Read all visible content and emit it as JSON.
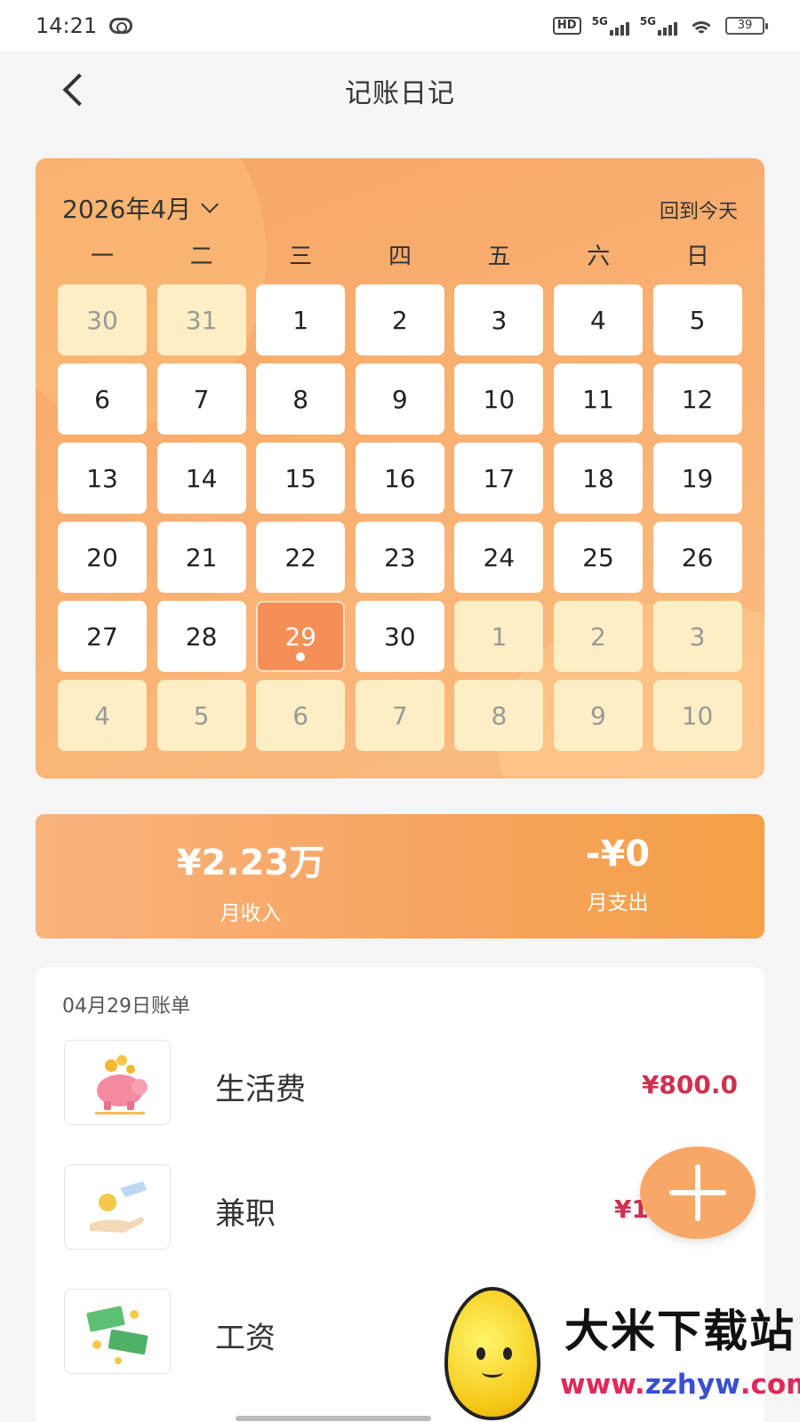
{
  "status_bar": {
    "time": "14:21",
    "hd_label": "HD",
    "signal1_label": "5G",
    "signal2_label": "5G",
    "battery": "39"
  },
  "header": {
    "title": "记账日记"
  },
  "calendar": {
    "month_label": "2026年4月",
    "today_button": "回到今天",
    "weekdays": [
      "一",
      "二",
      "三",
      "四",
      "五",
      "六",
      "日"
    ],
    "selected_day": "29",
    "days": [
      {
        "d": "30",
        "out": true
      },
      {
        "d": "31",
        "out": true
      },
      {
        "d": "1"
      },
      {
        "d": "2"
      },
      {
        "d": "3"
      },
      {
        "d": "4"
      },
      {
        "d": "5"
      },
      {
        "d": "6"
      },
      {
        "d": "7"
      },
      {
        "d": "8"
      },
      {
        "d": "9"
      },
      {
        "d": "10"
      },
      {
        "d": "11"
      },
      {
        "d": "12"
      },
      {
        "d": "13"
      },
      {
        "d": "14"
      },
      {
        "d": "15"
      },
      {
        "d": "16"
      },
      {
        "d": "17"
      },
      {
        "d": "18"
      },
      {
        "d": "19"
      },
      {
        "d": "20"
      },
      {
        "d": "21"
      },
      {
        "d": "22"
      },
      {
        "d": "23"
      },
      {
        "d": "24"
      },
      {
        "d": "25"
      },
      {
        "d": "26"
      },
      {
        "d": "27"
      },
      {
        "d": "28"
      },
      {
        "d": "29",
        "selected": true,
        "has_record": true
      },
      {
        "d": "30"
      },
      {
        "d": "1",
        "out": true
      },
      {
        "d": "2",
        "out": true
      },
      {
        "d": "3",
        "out": true
      },
      {
        "d": "4",
        "out": true
      },
      {
        "d": "5",
        "out": true
      },
      {
        "d": "6",
        "out": true
      },
      {
        "d": "7",
        "out": true
      },
      {
        "d": "8",
        "out": true
      },
      {
        "d": "9",
        "out": true
      },
      {
        "d": "10",
        "out": true
      }
    ]
  },
  "summary": {
    "income_value": "¥2.23万",
    "income_label": "月收入",
    "expense_value": "-¥0",
    "expense_label": "月支出"
  },
  "bill": {
    "title": "04月29日账单",
    "items": [
      {
        "name": "生活费",
        "amount": "¥800.0",
        "icon": "piggy-bank-icon"
      },
      {
        "name": "兼职",
        "amount": "¥1",
        "icon": "coin-hand-icon"
      },
      {
        "name": "工资",
        "amount": "",
        "icon": "money-bills-icon"
      }
    ]
  },
  "watermark": {
    "brand": "大米下载站",
    "url_a": "www.",
    "url_b": "zzhyw",
    "url_c": ".com"
  },
  "colors": {
    "accent": "#f8a766",
    "amount": "#d03050",
    "selected_day": "#f58f55",
    "out_of_month_day": "#fdeec5"
  }
}
